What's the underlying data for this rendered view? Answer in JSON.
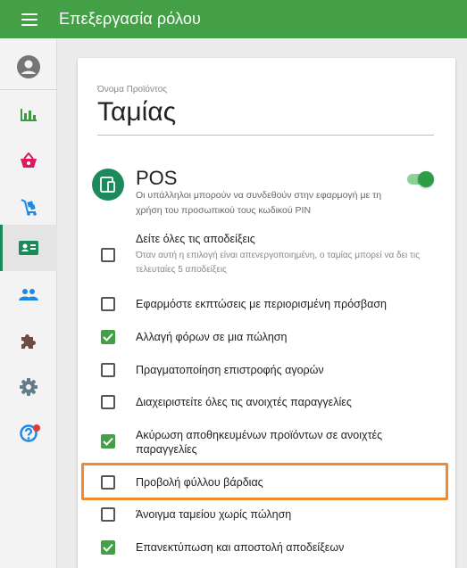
{
  "appbar": {
    "title": "Επεξεργασία ρόλου",
    "color": "#43a047"
  },
  "sidebar": {
    "items": [
      {
        "name": "account-icon",
        "color": "#757575"
      },
      {
        "name": "bar-chart-icon",
        "color": "#3a9a3d"
      },
      {
        "name": "basket-icon",
        "color": "#d81b60"
      },
      {
        "name": "cart-icon",
        "color": "#1e88e5"
      },
      {
        "name": "id-card-icon",
        "color": "#1b8a5a",
        "active": true
      },
      {
        "name": "people-icon",
        "color": "#1e88e5"
      },
      {
        "name": "puzzle-icon",
        "color": "#6d4c41"
      },
      {
        "name": "gear-icon",
        "color": "#607d8b"
      },
      {
        "name": "help-icon",
        "color": "#1e88e5",
        "badge": true
      }
    ]
  },
  "form": {
    "product_label": "Όνομα Προϊόντος",
    "product_value": "Ταμίας"
  },
  "pos": {
    "title": "POS",
    "description": "Οι υπάλληλοι μπορούν να συνδεθούν στην εφαρμογή με τη χρήση του προσωπικού τους κωδικού PIN",
    "enabled": true
  },
  "permissions": [
    {
      "label": "Δείτε όλες τις αποδείξεις",
      "sub": "Όταν αυτή η επιλογή είναι απενεργοποιημένη, ο ταμίας μπορεί να δει τις τελευταίες 5 αποδείξεις",
      "checked": false
    },
    {
      "label": "Εφαρμόστε εκπτώσεις με περιορισμένη πρόσβαση",
      "checked": false
    },
    {
      "label": "Αλλαγή φόρων σε μια πώληση",
      "checked": true
    },
    {
      "label": "Πραγματοποίηση επιστροφής αγορών",
      "checked": false
    },
    {
      "label": "Διαχειριστείτε όλες τις ανοιχτές παραγγελίες",
      "checked": false
    },
    {
      "label": "Ακύρωση αποθηκευμένων προϊόντων σε ανοιχτές παραγγελίες",
      "checked": true
    },
    {
      "label": "Προβολή φύλλου βάρδιας",
      "checked": false,
      "highlighted": true
    },
    {
      "label": "Άνοιγμα ταμείου χωρίς πώληση",
      "checked": false
    },
    {
      "label": "Επανεκτύπωση και αποστολή αποδείξεων",
      "checked": true
    }
  ]
}
